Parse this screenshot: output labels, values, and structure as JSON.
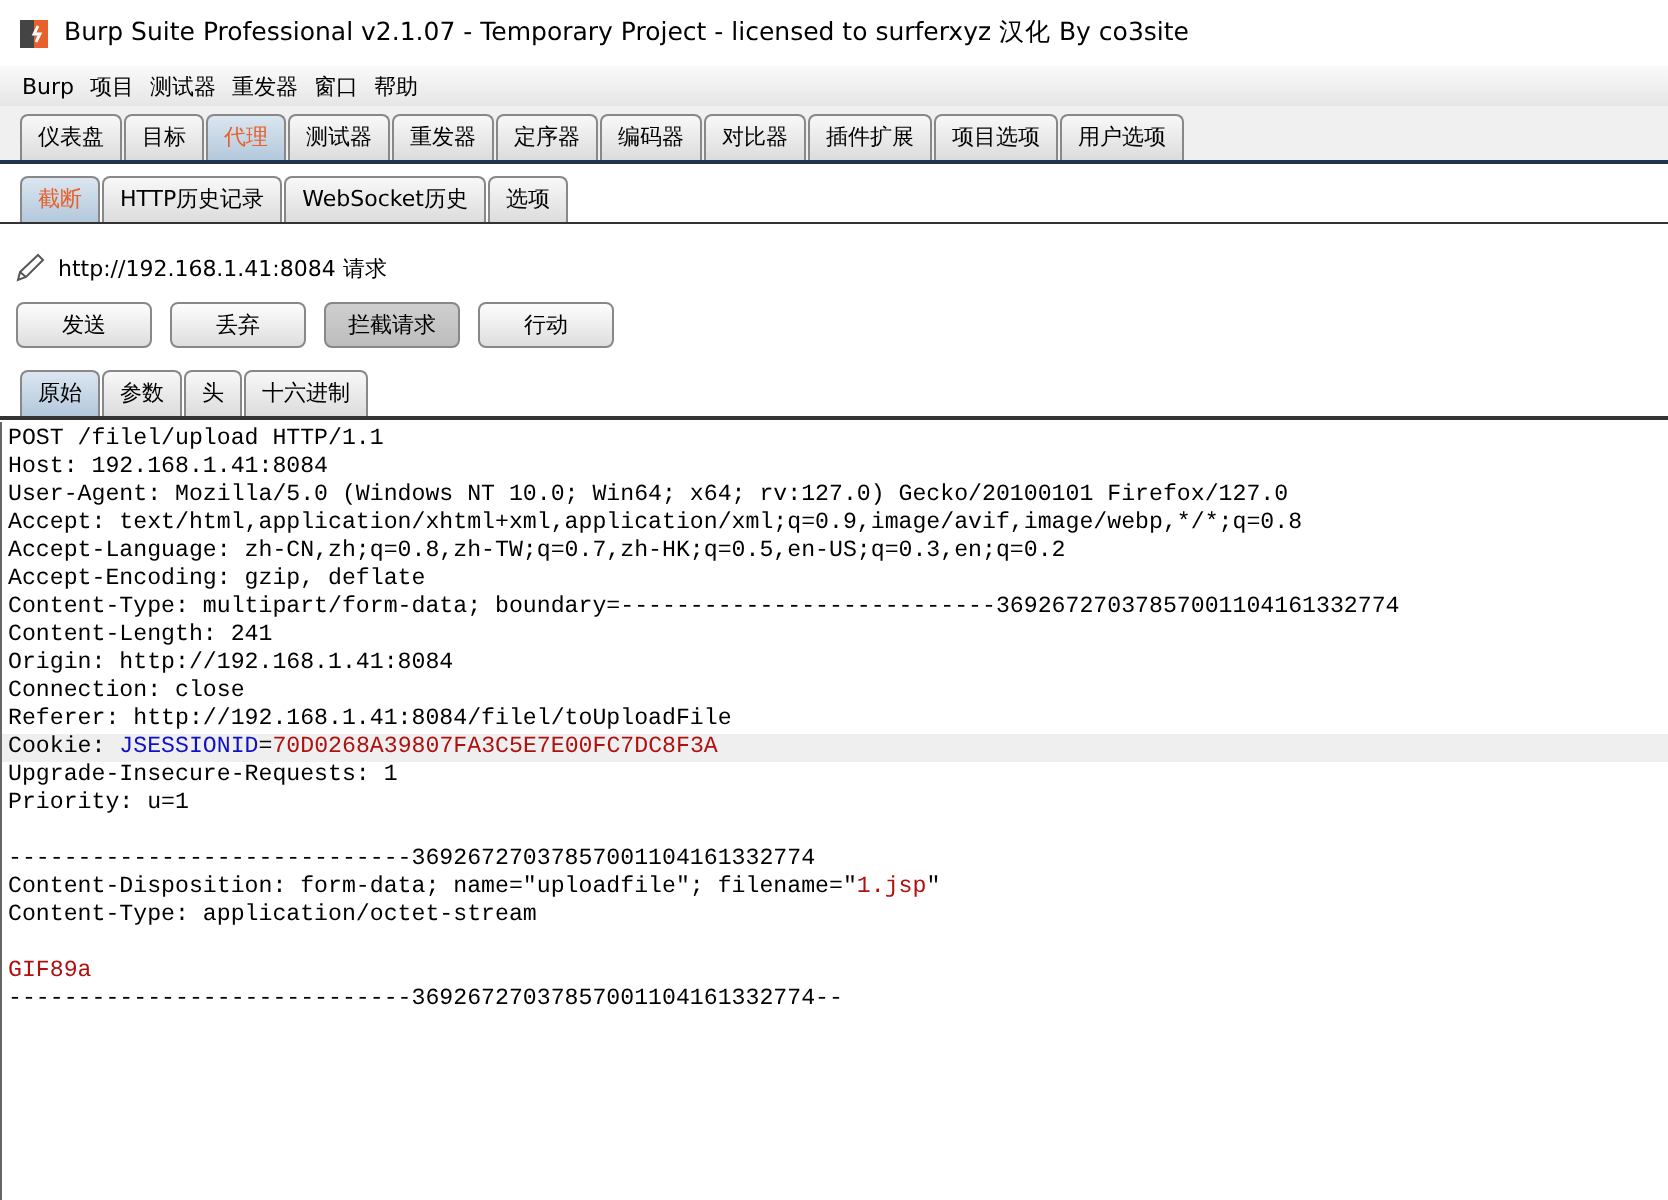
{
  "window": {
    "title": "Burp Suite Professional v2.1.07 - Temporary Project - licensed to surferxyz 汉化 By co3site"
  },
  "menu": [
    "Burp",
    "项目",
    "测试器",
    "重发器",
    "窗口",
    "帮助"
  ],
  "main_tabs": [
    {
      "label": "仪表盘",
      "selected": false
    },
    {
      "label": "目标",
      "selected": false
    },
    {
      "label": "代理",
      "selected": true
    },
    {
      "label": "测试器",
      "selected": false
    },
    {
      "label": "重发器",
      "selected": false
    },
    {
      "label": "定序器",
      "selected": false
    },
    {
      "label": "编码器",
      "selected": false
    },
    {
      "label": "对比器",
      "selected": false
    },
    {
      "label": "插件扩展",
      "selected": false
    },
    {
      "label": "项目选项",
      "selected": false
    },
    {
      "label": "用户选项",
      "selected": false
    }
  ],
  "proxy_tabs": [
    {
      "label": "截断",
      "selected": true
    },
    {
      "label": "HTTP历史记录",
      "selected": false
    },
    {
      "label": "WebSocket历史",
      "selected": false
    },
    {
      "label": "选项",
      "selected": false
    }
  ],
  "request_label": "http://192.168.1.41:8084 请求",
  "buttons": [
    {
      "label": "发送",
      "pressed": false
    },
    {
      "label": "丢弃",
      "pressed": false
    },
    {
      "label": "拦截请求",
      "pressed": true
    },
    {
      "label": "行动",
      "pressed": false
    }
  ],
  "editor_tabs": [
    {
      "label": "原始",
      "selected": true
    },
    {
      "label": "参数",
      "selected": false
    },
    {
      "label": "头",
      "selected": false
    },
    {
      "label": "十六进制",
      "selected": false
    }
  ],
  "request_lines": [
    {
      "kind": "text",
      "highlighted": false,
      "segments": [
        {
          "kind": "plain",
          "text": "POST /filel/upload HTTP/1.1"
        }
      ]
    },
    {
      "kind": "text",
      "highlighted": false,
      "segments": [
        {
          "kind": "plain",
          "text": "Host: 192.168.1.41:8084"
        }
      ]
    },
    {
      "kind": "text",
      "highlighted": false,
      "segments": [
        {
          "kind": "plain",
          "text": "User-Agent: Mozilla/5.0 (Windows NT 10.0; Win64; x64; rv:127.0) Gecko/20100101 Firefox/127.0"
        }
      ]
    },
    {
      "kind": "text",
      "highlighted": false,
      "segments": [
        {
          "kind": "plain",
          "text": "Accept: text/html,application/xhtml+xml,application/xml;q=0.9,image/avif,image/webp,*/*;q=0.8"
        }
      ]
    },
    {
      "kind": "text",
      "highlighted": false,
      "segments": [
        {
          "kind": "plain",
          "text": "Accept-Language: zh-CN,zh;q=0.8,zh-TW;q=0.7,zh-HK;q=0.5,en-US;q=0.3,en;q=0.2"
        }
      ]
    },
    {
      "kind": "text",
      "highlighted": false,
      "segments": [
        {
          "kind": "plain",
          "text": "Accept-Encoding: gzip, deflate"
        }
      ]
    },
    {
      "kind": "text",
      "highlighted": false,
      "segments": [
        {
          "kind": "plain",
          "text": "Content-Type: multipart/form-data; boundary=---------------------------36926727037857001104161332774"
        }
      ]
    },
    {
      "kind": "text",
      "highlighted": false,
      "segments": [
        {
          "kind": "plain",
          "text": "Content-Length: 241"
        }
      ]
    },
    {
      "kind": "text",
      "highlighted": false,
      "segments": [
        {
          "kind": "plain",
          "text": "Origin: http://192.168.1.41:8084"
        }
      ]
    },
    {
      "kind": "text",
      "highlighted": false,
      "segments": [
        {
          "kind": "plain",
          "text": "Connection: close"
        }
      ]
    },
    {
      "kind": "text",
      "highlighted": false,
      "segments": [
        {
          "kind": "plain",
          "text": "Referer: http://192.168.1.41:8084/filel/toUploadFile"
        }
      ]
    },
    {
      "kind": "text",
      "highlighted": true,
      "segments": [
        {
          "kind": "plain",
          "text": "Cookie: "
        },
        {
          "kind": "name",
          "text": "JSESSIONID"
        },
        {
          "kind": "plain",
          "text": "="
        },
        {
          "kind": "value",
          "text": "70D0268A39807FA3C5E7E00FC7DC8F3A"
        }
      ]
    },
    {
      "kind": "text",
      "highlighted": false,
      "segments": [
        {
          "kind": "plain",
          "text": "Upgrade-Insecure-Requests: 1"
        }
      ]
    },
    {
      "kind": "text",
      "highlighted": false,
      "segments": [
        {
          "kind": "plain",
          "text": "Priority: u=1"
        }
      ]
    },
    {
      "kind": "blank"
    },
    {
      "kind": "text",
      "highlighted": false,
      "segments": [
        {
          "kind": "plain",
          "text": "-----------------------------36926727037857001104161332774"
        }
      ]
    },
    {
      "kind": "text",
      "highlighted": false,
      "segments": [
        {
          "kind": "plain",
          "text": "Content-Disposition: form-data; name=\"uploadfile\"; filename=\""
        },
        {
          "kind": "value",
          "text": "1.jsp"
        },
        {
          "kind": "plain",
          "text": "\""
        }
      ]
    },
    {
      "kind": "text",
      "highlighted": false,
      "segments": [
        {
          "kind": "plain",
          "text": "Content-Type: application/octet-stream"
        }
      ]
    },
    {
      "kind": "blank"
    },
    {
      "kind": "text",
      "highlighted": false,
      "segments": [
        {
          "kind": "value",
          "text": "GIF89a"
        }
      ]
    },
    {
      "kind": "text",
      "highlighted": false,
      "segments": [
        {
          "kind": "plain",
          "text": "-----------------------------36926727037857001104161332774--"
        }
      ]
    }
  ]
}
